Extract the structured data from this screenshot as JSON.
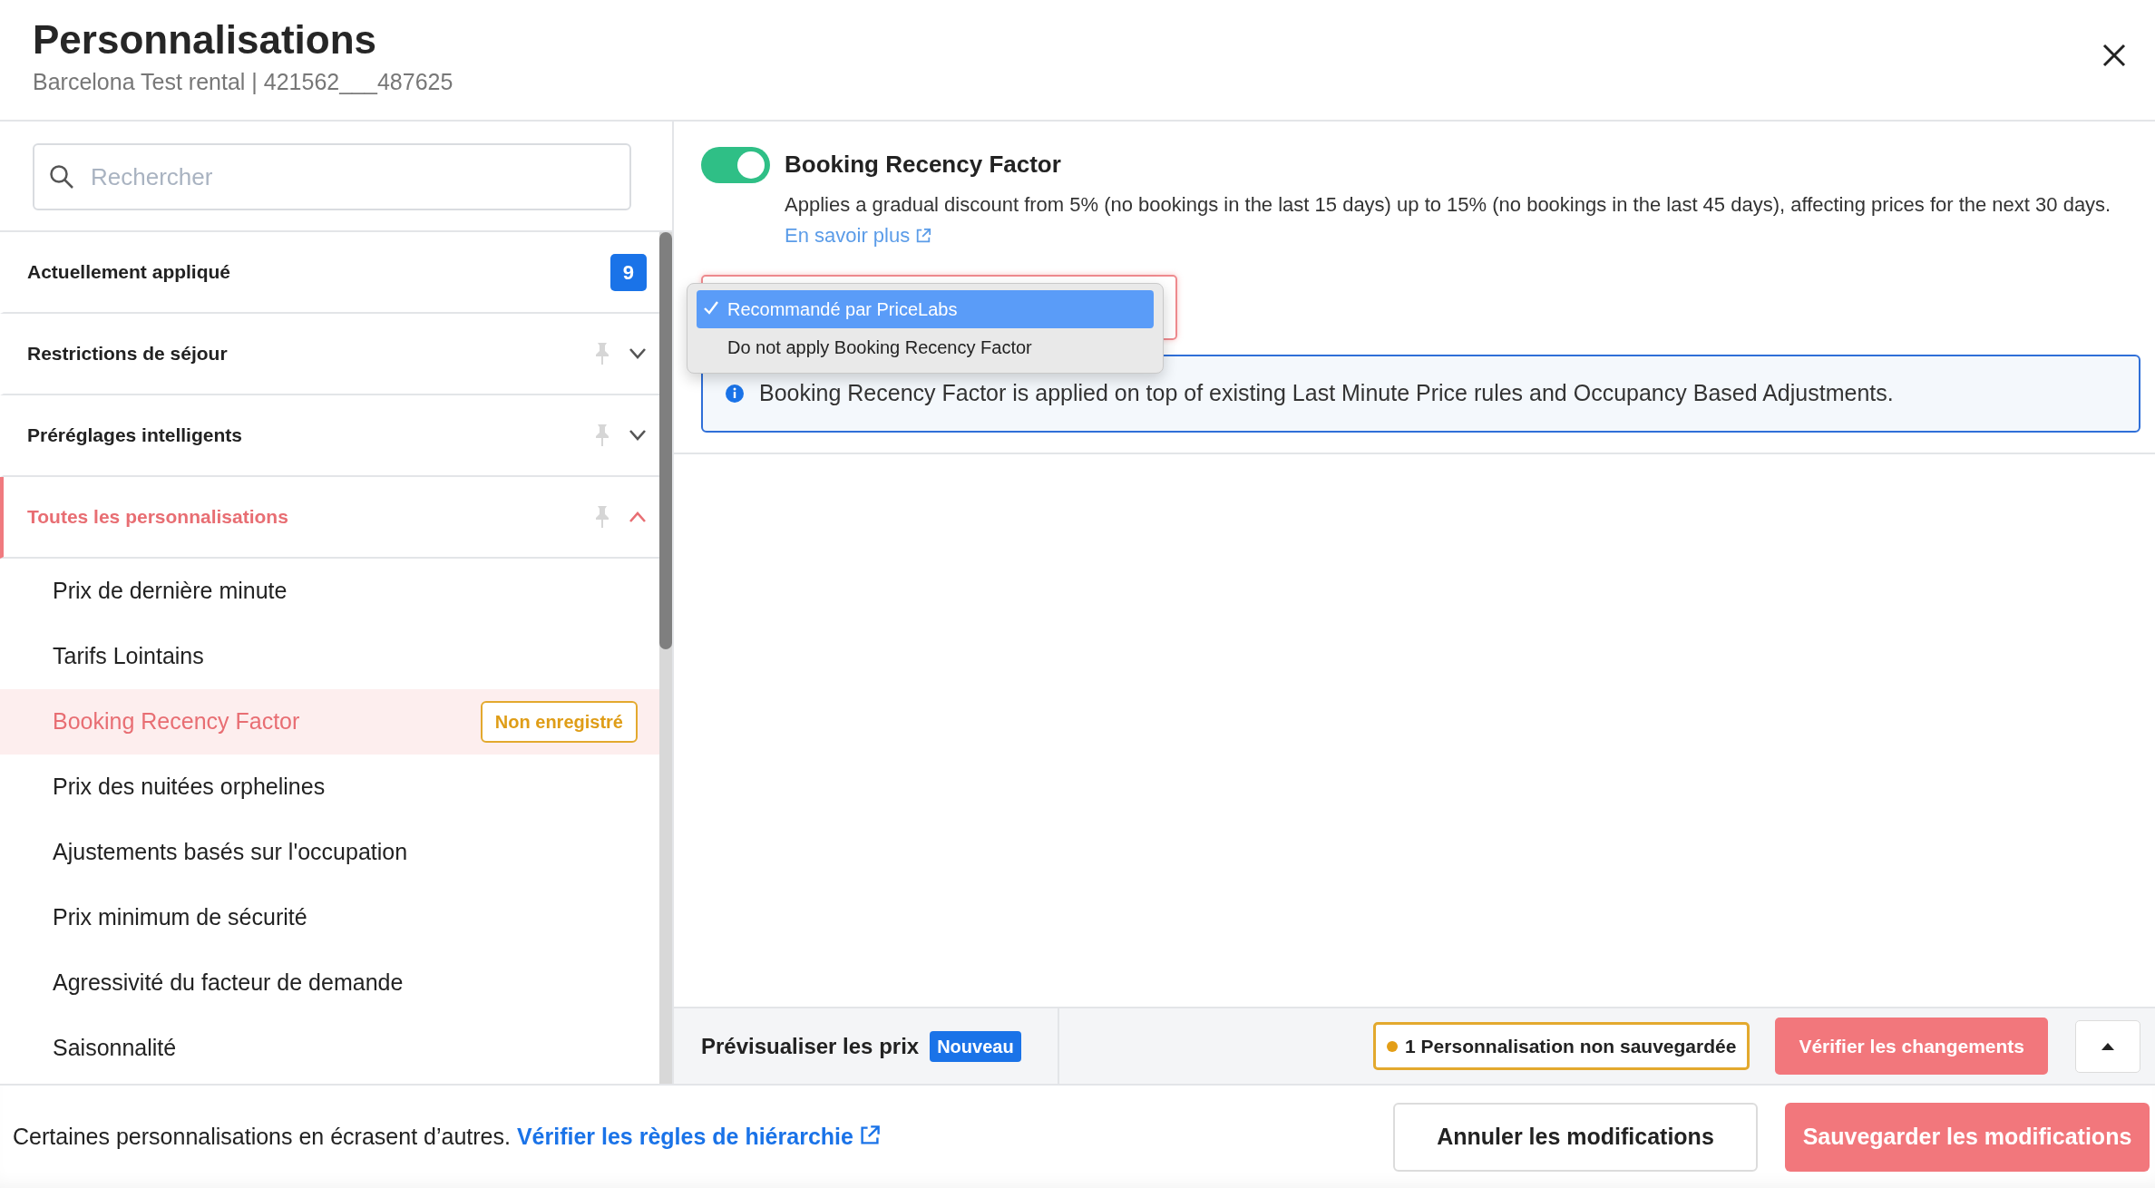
{
  "header": {
    "title": "Personnalisations",
    "subtitle": "Barcelona Test rental | 421562___487625"
  },
  "sidebar": {
    "search": {
      "placeholder": "Rechercher"
    },
    "applied": {
      "label": "Actuellement appliqué",
      "count": "9"
    },
    "groups": [
      {
        "label": "Restrictions de séjour",
        "expanded": false,
        "selected": false
      },
      {
        "label": "Préréglages intelligents",
        "expanded": false,
        "selected": false
      },
      {
        "label": "Toutes les personnalisations",
        "expanded": true,
        "selected": true
      }
    ],
    "items": [
      {
        "label": "Prix de dernière minute",
        "selected": false
      },
      {
        "label": "Tarifs Lointains",
        "selected": false
      },
      {
        "label": "Booking Recency Factor",
        "selected": true,
        "tag": "Non enregistré"
      },
      {
        "label": "Prix des nuitées orphelines",
        "selected": false
      },
      {
        "label": "Ajustements basés sur l'occupation",
        "selected": false
      },
      {
        "label": "Prix minimum de sécurité",
        "selected": false
      },
      {
        "label": "Agressivité du facteur de demande",
        "selected": false
      },
      {
        "label": "Saisonnalité",
        "selected": false
      }
    ]
  },
  "setting": {
    "enabled": true,
    "title": "Booking Recency Factor",
    "description": "Applies a gradual discount from 5% (no bookings in the last 15 days) up to 15% (no bookings in the last 45 days), affecting prices for the next 30 days.",
    "link": "En savoir plus",
    "options": [
      {
        "label": "Recommandé par PriceLabs",
        "selected": true
      },
      {
        "label": "Do not apply Booking Recency Factor",
        "selected": false
      }
    ],
    "info": "Booking Recency Factor is applied on top of existing Last Minute Price rules and Occupancy Based Adjustments."
  },
  "preview_bar": {
    "label": "Prévisualiser les prix",
    "badge": "Nouveau",
    "unsaved": "1 Personnalisation non sauvegardée",
    "verify_button": "Vérifier les changements"
  },
  "footer": {
    "text": "Certaines personnalisations en écrasent d’autres.",
    "link": "Vérifier les règles de hiérarchie",
    "cancel_button": "Annuler les modifications",
    "save_button": "Sauvegarder les modifications"
  }
}
